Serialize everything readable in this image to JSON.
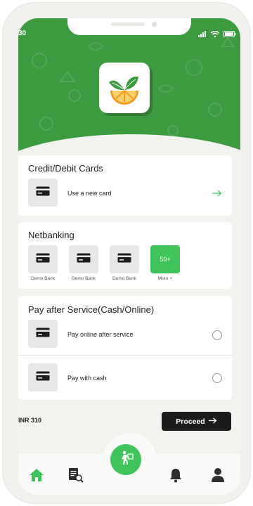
{
  "status": {
    "time": "30"
  },
  "credit": {
    "title": "Credit/Debit Cards",
    "new_card": "Use a new card"
  },
  "netbanking": {
    "title": "Netbanking",
    "banks": [
      "Demo Bank",
      "Demo Bank",
      "Demo Bank"
    ],
    "more_badge": "50+",
    "more_label": "More +"
  },
  "pay_after": {
    "title": "Pay after Service(Cash/Online)",
    "options": [
      "Pay online after service",
      "Pay with cash"
    ]
  },
  "footer": {
    "total": "INR 310",
    "proceed_label": "Proceed"
  },
  "colors": {
    "brand_green": "#3c9a3f",
    "accent_green": "#3ec45a",
    "dark_button": "#1c1c1c"
  },
  "icons": [
    "wifi-icon",
    "signal-icon",
    "battery-icon",
    "app-logo",
    "card-icon",
    "arrow-right-icon",
    "home-icon",
    "orders-icon",
    "service-man-icon",
    "bell-icon",
    "profile-icon"
  ]
}
